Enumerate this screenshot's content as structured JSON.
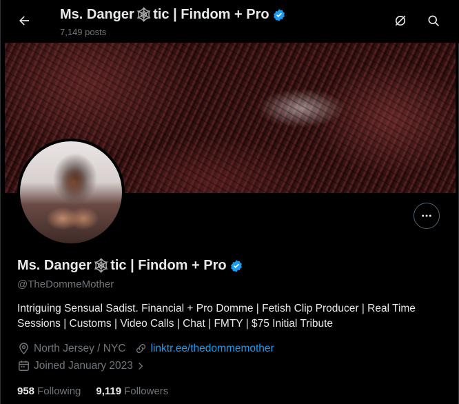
{
  "header": {
    "title_before": "Ms. Danger",
    "title_glyph": "🕸",
    "title_after": "tic | Findom + Pro",
    "post_count": "7,149 posts"
  },
  "icons": {
    "back": "arrow-left-icon",
    "notify": "notification-off-icon",
    "search": "search-icon",
    "more": "more-dots-icon",
    "verified": "verified-badge-icon",
    "location": "location-pin-icon",
    "link": "link-icon",
    "calendar": "calendar-icon"
  },
  "colors": {
    "accent": "#1d9bf0",
    "background": "#000000",
    "text": "#e7e9ea",
    "muted": "#71767b"
  },
  "profile": {
    "name_before": "Ms. Danger",
    "name_glyph": "🕸",
    "name_after": "tic | Findom + Pro",
    "handle": "@TheDommeMother",
    "bio": "Intriguing Sensual Sadist. Financial + Pro Domme | Fetish Clip Producer | Real Time Sessions | Customs | Video Calls | Chat | FMTY | $75 Initial Tribute",
    "location": "North Jersey / NYC",
    "website": "linktr.ee/thedommemother",
    "joined": "Joined January 2023",
    "following_count": "958",
    "following_label": "Following",
    "followers_count": "9,119",
    "followers_label": "Followers"
  }
}
